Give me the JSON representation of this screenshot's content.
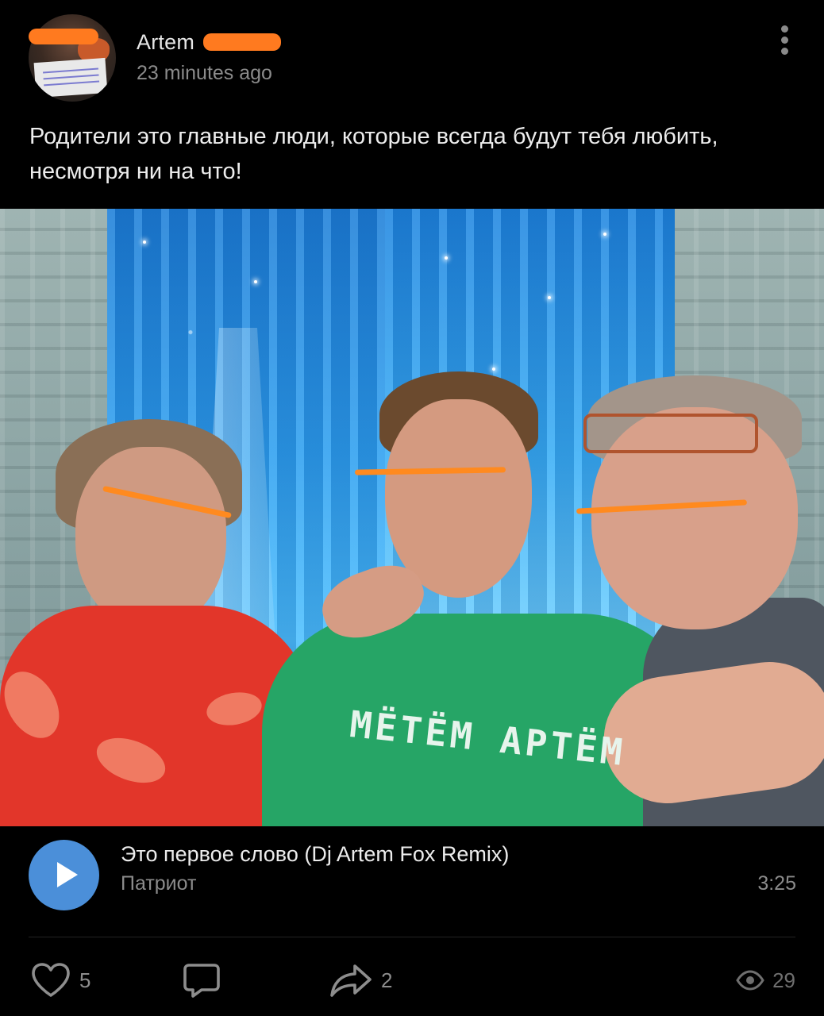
{
  "post": {
    "author": "Artem",
    "time": "23 minutes ago",
    "text": "Родители это главные люди, которые всегда будут тебя любить, несмотря ни на что!",
    "more_icon": "more-vertical-icon"
  },
  "photo": {
    "shirt_print": "МЁТЁМ АРТЁМ"
  },
  "audio": {
    "title": "Это первое слово (Dj Artem Fox Remix)",
    "artist": "Патриот",
    "duration": "3:25",
    "play_icon": "play-icon",
    "accent_color": "#4b8fd9"
  },
  "actions": {
    "likes": "5",
    "comments": "",
    "shares": "2",
    "views": "29"
  }
}
